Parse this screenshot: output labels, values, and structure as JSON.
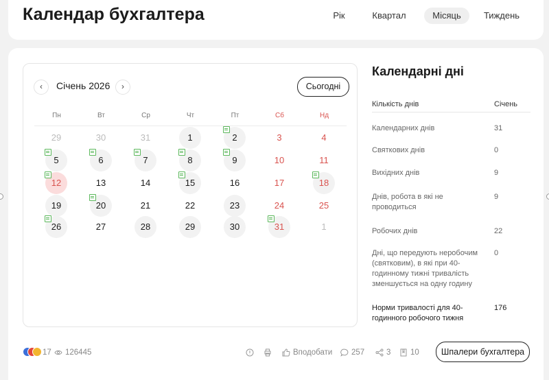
{
  "header": {
    "title": "Календар бухгалтера",
    "tabs": [
      {
        "label": "Рік"
      },
      {
        "label": "Квартал"
      },
      {
        "label": "Місяць",
        "active": true
      },
      {
        "label": "Тиждень"
      }
    ]
  },
  "calendar": {
    "month_label": "Січень 2026",
    "today_label": "Сьогодні",
    "weekdays": [
      "Пн",
      "Вт",
      "Ср",
      "Чт",
      "Пт",
      "Сб",
      "Нд"
    ],
    "weeks": [
      [
        {
          "d": "29",
          "t": "other"
        },
        {
          "d": "30",
          "t": "other"
        },
        {
          "d": "31",
          "t": "other"
        },
        {
          "d": "1",
          "t": "work"
        },
        {
          "d": "2",
          "t": "work",
          "note": true
        },
        {
          "d": "3",
          "t": "weekend"
        },
        {
          "d": "4",
          "t": "weekend"
        }
      ],
      [
        {
          "d": "5",
          "t": "work",
          "note": true
        },
        {
          "d": "6",
          "t": "work",
          "note": true
        },
        {
          "d": "7",
          "t": "work",
          "note": true
        },
        {
          "d": "8",
          "t": "work",
          "note": true
        },
        {
          "d": "9",
          "t": "work",
          "note": true
        },
        {
          "d": "10",
          "t": "weekend"
        },
        {
          "d": "11",
          "t": "weekend"
        }
      ],
      [
        {
          "d": "12",
          "t": "holiday",
          "note": true
        },
        {
          "d": "13",
          "t": "plain"
        },
        {
          "d": "14",
          "t": "plain"
        },
        {
          "d": "15",
          "t": "work",
          "note": true
        },
        {
          "d": "16",
          "t": "plain"
        },
        {
          "d": "17",
          "t": "weekend"
        },
        {
          "d": "18",
          "t": "pre",
          "note": true
        }
      ],
      [
        {
          "d": "19",
          "t": "work"
        },
        {
          "d": "20",
          "t": "work",
          "note": true
        },
        {
          "d": "21",
          "t": "plain"
        },
        {
          "d": "22",
          "t": "plain"
        },
        {
          "d": "23",
          "t": "work"
        },
        {
          "d": "24",
          "t": "weekend"
        },
        {
          "d": "25",
          "t": "weekend"
        }
      ],
      [
        {
          "d": "26",
          "t": "work",
          "note": true
        },
        {
          "d": "27",
          "t": "plain"
        },
        {
          "d": "28",
          "t": "work"
        },
        {
          "d": "29",
          "t": "work"
        },
        {
          "d": "30",
          "t": "work"
        },
        {
          "d": "31",
          "t": "pre",
          "note": true
        },
        {
          "d": "1",
          "t": "other"
        }
      ]
    ]
  },
  "side": {
    "title": "Календарні дні",
    "col_label": "Кількість днів",
    "col_month": "Січень",
    "rows": [
      {
        "label": "Календарних днів",
        "value": "31"
      },
      {
        "label": "Святкових днів",
        "value": "0"
      },
      {
        "label": "Вихідних днів",
        "value": "9"
      },
      {
        "label": "Днів, робота в які не проводиться",
        "value": "9"
      },
      {
        "label": "Робочих днів",
        "value": "22"
      },
      {
        "label": "Дні, що передують неробочим (святковим), в які при 40-годинному тижні тривалість зменшується на одну годину",
        "value": "0"
      },
      {
        "label": "Норми тривалості для 40-годинного робочого тижня",
        "value": "176",
        "bold": true
      }
    ]
  },
  "footer": {
    "reactions": "17",
    "views": "126445",
    "like_label": "Вподобати",
    "comments": "257",
    "shares": "3",
    "bookmarks": "10",
    "wallpaper_button": "Шпалери бухгалтера"
  },
  "colors": {
    "weekend": "#d9534f",
    "holiday_bg": "#fbdcdc",
    "note": "#5cb85c"
  }
}
